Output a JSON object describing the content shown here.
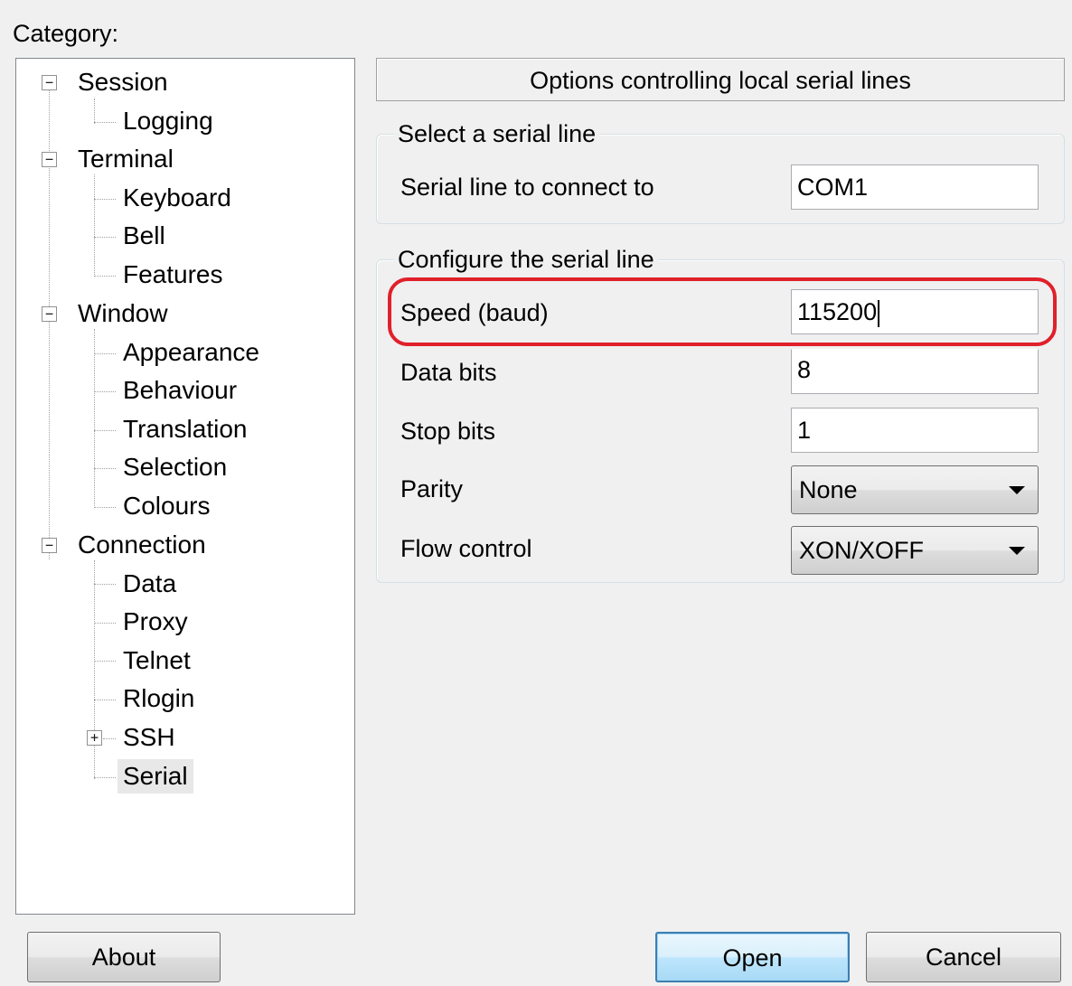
{
  "category_label": "Category:",
  "tree": {
    "items": [
      {
        "label": "Session",
        "expander": "⊟"
      },
      {
        "label": "Logging"
      },
      {
        "label": "Terminal",
        "expander": "⊟"
      },
      {
        "label": "Keyboard"
      },
      {
        "label": "Bell"
      },
      {
        "label": "Features"
      },
      {
        "label": "Window",
        "expander": "⊟"
      },
      {
        "label": "Appearance"
      },
      {
        "label": "Behaviour"
      },
      {
        "label": "Translation"
      },
      {
        "label": "Selection"
      },
      {
        "label": "Colours"
      },
      {
        "label": "Connection",
        "expander": "⊟"
      },
      {
        "label": "Data"
      },
      {
        "label": "Proxy"
      },
      {
        "label": "Telnet"
      },
      {
        "label": "Rlogin"
      },
      {
        "label": "SSH",
        "expander": "⊞"
      },
      {
        "label": "Serial",
        "selected": true
      }
    ]
  },
  "panel": {
    "header": "Options controlling local serial lines",
    "group_select": {
      "title": "Select a serial line",
      "serial_line_label": "Serial line to connect to",
      "serial_line_value": "COM1"
    },
    "group_config": {
      "title": "Configure the serial line",
      "speed_label": "Speed (baud)",
      "speed_value": "115200",
      "data_bits_label": "Data bits",
      "data_bits_value": "8",
      "stop_bits_label": "Stop bits",
      "stop_bits_value": "1",
      "parity_label": "Parity",
      "parity_value": "None",
      "flow_label": "Flow control",
      "flow_value": "XON/XOFF"
    }
  },
  "buttons": {
    "about": "About",
    "open": "Open",
    "cancel": "Cancel"
  },
  "colors": {
    "highlight": "#e0202a",
    "selection": "#e8e8e8"
  }
}
